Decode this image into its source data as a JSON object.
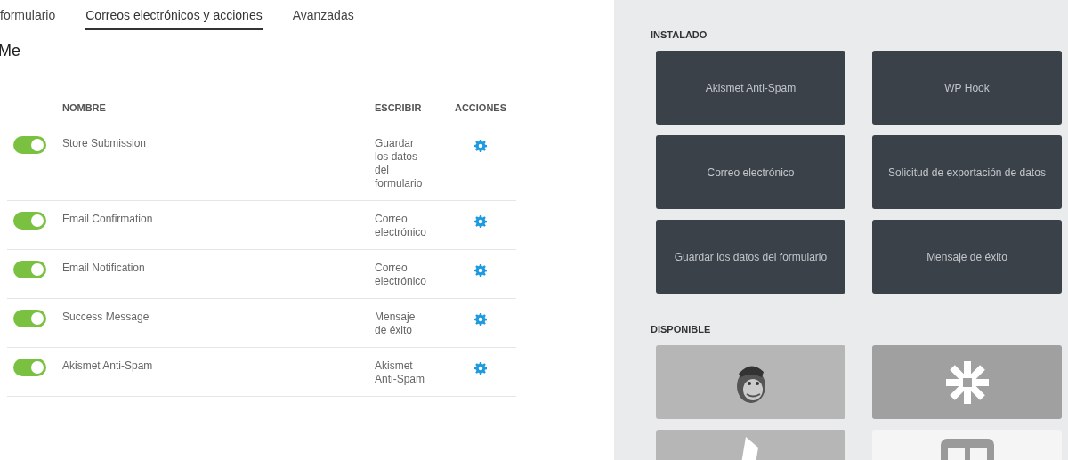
{
  "tabs": [
    {
      "label": "formulario",
      "selected": false
    },
    {
      "label": "Correos electrónicos y acciones",
      "selected": true
    },
    {
      "label": "Avanzadas",
      "selected": false
    }
  ],
  "heading": "Me",
  "table": {
    "columns": [
      "NOMBRE",
      "ESCRIBIR",
      "ACCIONES"
    ],
    "rows": [
      {
        "on": true,
        "name": "Store Submission",
        "type": "Guardar los datos del formulario"
      },
      {
        "on": true,
        "name": "Email Confirmation",
        "type": "Correo electrónico"
      },
      {
        "on": true,
        "name": "Email Notification",
        "type": "Correo electrónico"
      },
      {
        "on": true,
        "name": "Success Message",
        "type": "Mensaje de éxito"
      },
      {
        "on": true,
        "name": "Akismet Anti-Spam",
        "type": "Akismet Anti-Spam"
      }
    ]
  },
  "installed": {
    "title": "INSTALADO",
    "tiles": [
      "Akismet Anti-Spam",
      "WP Hook",
      "Correo electrónico",
      "Solicitud de exportación de datos",
      "Guardar los datos del formulario",
      "Mensaje de éxito"
    ]
  },
  "available": {
    "title": "DISPONIBLE",
    "tiles": [
      {
        "kind": "monkey"
      },
      {
        "kind": "asterisk"
      },
      {
        "kind": "pencil"
      },
      {
        "kind": "panels"
      }
    ]
  }
}
